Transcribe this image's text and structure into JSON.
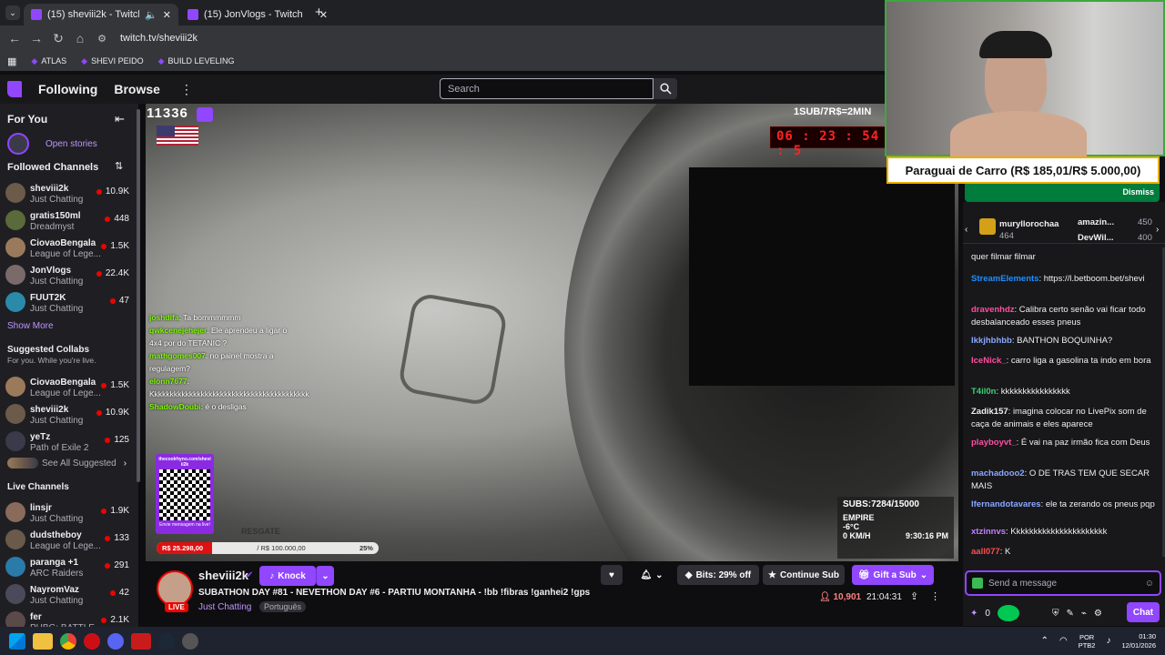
{
  "browser": {
    "tabs": [
      {
        "title": "(15) sheviii2k - Twitch",
        "active": true
      },
      {
        "title": "(15) JonVlogs - Twitch",
        "active": false
      }
    ],
    "url": "twitch.tv/sheviii2k",
    "bookmarks": [
      "ATLAS",
      "SHEVI PEIDO",
      "BUILD LEVELING"
    ]
  },
  "topnav": {
    "following": "Following",
    "browse": "Browse",
    "search_placeholder": "Search"
  },
  "sidebar": {
    "for_you": "For You",
    "open_stories": "Open stories",
    "followed_title": "Followed Channels",
    "followed": [
      {
        "name": "sheviii2k",
        "game": "Just Chatting",
        "viewers": "10.9K",
        "color": "#6c5a4a"
      },
      {
        "name": "gratis150ml",
        "game": "Dreadmyst",
        "viewers": "448",
        "color": "#5a6a3a"
      },
      {
        "name": "CiovaoBengala",
        "game": "League of Lege...",
        "viewers": "1.5K",
        "color": "#9a7a5a"
      },
      {
        "name": "JonVlogs",
        "game": "Just Chatting",
        "viewers": "22.4K",
        "color": "#7a6a6a"
      },
      {
        "name": "FUUT2K",
        "game": "Just Chatting",
        "viewers": "47",
        "color": "#2a8aaa"
      }
    ],
    "show_more": "Show More",
    "collabs_title": "Suggested Collabs",
    "collabs_sub": "For you. While you're live.",
    "collabs": [
      {
        "name": "CiovaoBengala",
        "game": "League of Lege...",
        "viewers": "1.5K",
        "color": "#9a7a5a"
      },
      {
        "name": "sheviii2k",
        "game": "Just Chatting",
        "viewers": "10.9K",
        "color": "#6c5a4a"
      },
      {
        "name": "yeTz",
        "game": "Path of Exile 2",
        "viewers": "125",
        "color": "#3a3a4a"
      }
    ],
    "see_all": "See All Suggested",
    "live_title": "Live Channels",
    "live": [
      {
        "name": "linsjr",
        "game": "Just Chatting",
        "viewers": "1.9K",
        "color": "#8a6a5a"
      },
      {
        "name": "dudstheboy",
        "game": "League of Lege...",
        "viewers": "133",
        "color": "#6a5a4a"
      },
      {
        "name": "paranga +1",
        "game": "ARC Raiders",
        "viewers": "291",
        "color": "#2a7aaa"
      },
      {
        "name": "NayromVaz",
        "game": "Just Chatting",
        "viewers": "42",
        "color": "#4a4a5a"
      },
      {
        "name": "fer",
        "game": "PUBG: BATTLE...",
        "viewers": "2.1K",
        "color": "#5a4a4a"
      }
    ]
  },
  "overlay": {
    "count": "11336",
    "sub_rate": "1SUB/7R$=2MIN",
    "timer": "06 : 23 : 54 : 5",
    "chat": [
      {
        "user": "joshdlfa",
        "text": ": Ta bommmmmm"
      },
      {
        "user": "qwkcenejehejer",
        "text": ": Ele aprendeu a ligar o 4x4 por do TETANIC ?"
      },
      {
        "user": "mathgomes007",
        "text": ": no painel mostra a regulagem?"
      },
      {
        "user": "elonn7677",
        "text": ": Kkkkkkkkkkkkkkkkkkkkkkkkkkkkkkkkkkkkkkkkk"
      },
      {
        "user": "ShadowDoubi",
        "text": ": é o desligas"
      }
    ],
    "qr_label": "thecoolrhyno.com/sheviii2k",
    "qr_sub": "Envie mensagem na live!",
    "resgate": "RESGATE",
    "progress_left": "R$ 25.298,00",
    "progress_goal": "/ R$ 100.000,00",
    "progress_pct": "25%",
    "progress_value": 0.25,
    "subs": "SUBS:7284/15000",
    "empire": "EMPIRE",
    "temp": "-6°C",
    "speed": "0 KM/H",
    "clock": "9:30:16 PM"
  },
  "webcam_goal": {
    "text": "Paraguai de Carro (R$ 185,01/R$ 5.000,00)",
    "dismiss": "Dismiss"
  },
  "chat": {
    "gift_top": {
      "user": "muryllorochaa",
      "count": "464"
    },
    "gift_others": [
      {
        "user": "amazin...",
        "count": "450"
      },
      {
        "user": "DevWil...",
        "count": "400"
      }
    ],
    "messages": [
      {
        "user": "",
        "text": "quer filmar filmar",
        "color": "#efeff1"
      },
      {
        "user": "StreamElements",
        "text": ": https://l.betboom.bet/shevi",
        "color": "#1e90ff"
      },
      {
        "user": "dravenhdz",
        "text": ": Calibra certo senão vai ficar todo desbalanceado esses pneus",
        "color": "#ff4fa0"
      },
      {
        "user": "lkkjhbhbb",
        "text": ": BANTHON BOQUINHA?",
        "color": "#8aa8ff"
      },
      {
        "user": "IceNick_",
        "text": ": carro liga a gasolina ta indo em bora",
        "color": "#ff4fa0"
      },
      {
        "user": "T4il0n",
        "text": ": kkkkkkkkkkkkkkkk",
        "color": "#3cd070"
      },
      {
        "user": "Zadik157",
        "text": ": imagina colocar no LivePix som de caça de animais e eles aparece",
        "color": "#efeff1"
      },
      {
        "user": "playboyvt_",
        "text": ": É vai na paz irmão fica com Deus",
        "color": "#ff4fa0"
      },
      {
        "user": "machadooo2",
        "text": ": O DE TRAS TEM QUE SECAR MAIS",
        "color": "#8aa8ff"
      },
      {
        "user": "lfernandotavares",
        "text": ": ele ta zerando os pneus pqp",
        "color": "#8aa8ff"
      },
      {
        "user": "xtzinnvs",
        "text": ": Kkkkkkkkkkkkkkkkkkkkkk",
        "color": "#c080ff"
      },
      {
        "user": "aall077",
        "text": ": K",
        "color": "#ff4f4f"
      }
    ],
    "input_placeholder": "Send a message",
    "points": "0",
    "chat_button": "Chat"
  },
  "stream": {
    "channel": "sheviii2k",
    "title": "SUBATHON DAY #81 - NEVETHON DAY #6 - PARTIU MONTANHA - !bb !fibras !ganhei2 !gps",
    "category": "Just Chatting",
    "tag": "Português",
    "live": "LIVE",
    "knock": "Knock",
    "bits": "Bits: 29% off",
    "continue_sub": "Continue Sub",
    "gift_sub": "Gift a Sub",
    "viewers": "10,901",
    "uptime": "21:04:31"
  },
  "taskbar": {
    "lang": "POR",
    "layout": "PTB2",
    "time": "01:30",
    "date": "12/01/2026"
  }
}
